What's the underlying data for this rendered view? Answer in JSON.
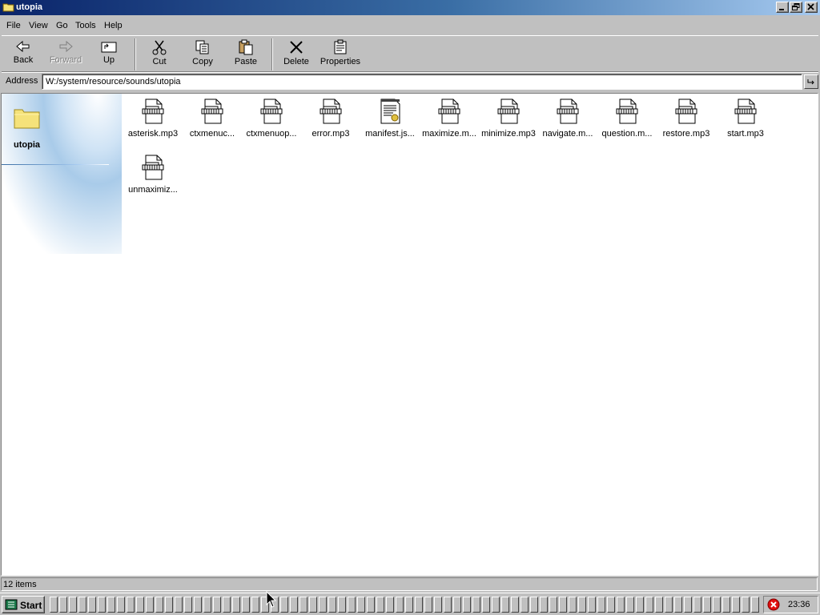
{
  "window": {
    "title": "utopia"
  },
  "menu": [
    "File",
    "View",
    "Go",
    "Tools",
    "Help"
  ],
  "toolbar": {
    "back": "Back",
    "forward": "Forward",
    "up": "Up",
    "cut": "Cut",
    "copy": "Copy",
    "paste": "Paste",
    "delete": "Delete",
    "properties": "Properties"
  },
  "address": {
    "label": "Address",
    "value": "W:/system/resource/sounds/utopia"
  },
  "sidepanel": {
    "folder_name": "utopia"
  },
  "files": [
    {
      "name": "asterisk.mp3",
      "icon": "audio-file-icon"
    },
    {
      "name": "ctxmenuc...",
      "icon": "audio-file-icon"
    },
    {
      "name": "ctxmenuop...",
      "icon": "audio-file-icon"
    },
    {
      "name": "error.mp3",
      "icon": "audio-file-icon"
    },
    {
      "name": "manifest.js...",
      "icon": "text-file-icon"
    },
    {
      "name": "maximize.m...",
      "icon": "audio-file-icon"
    },
    {
      "name": "minimize.mp3",
      "icon": "audio-file-icon"
    },
    {
      "name": "navigate.m...",
      "icon": "audio-file-icon"
    },
    {
      "name": "question.m...",
      "icon": "audio-file-icon"
    },
    {
      "name": "restore.mp3",
      "icon": "audio-file-icon"
    },
    {
      "name": "start.mp3",
      "icon": "audio-file-icon"
    },
    {
      "name": "unmaximiz...",
      "icon": "audio-file-icon"
    }
  ],
  "status": {
    "text": "12 items"
  },
  "taskbar": {
    "start_label": "Start",
    "clock": "23:36"
  },
  "colors": {
    "title_start": "#0a246a",
    "title_end": "#a6caf0",
    "face": "#c0c0c0",
    "folder": "#f5e27a"
  }
}
